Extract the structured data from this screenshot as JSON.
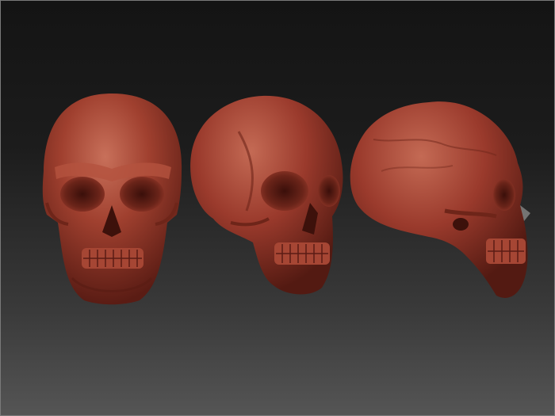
{
  "scene": {
    "views": [
      "front-view",
      "three-quarter-view",
      "side-view"
    ],
    "colors": {
      "background_top": "#141414",
      "background_bottom": "#555555",
      "clay": "#9a3a2c",
      "clay_highlight": "#c56a55",
      "clay_shadow": "#4a1812"
    }
  }
}
